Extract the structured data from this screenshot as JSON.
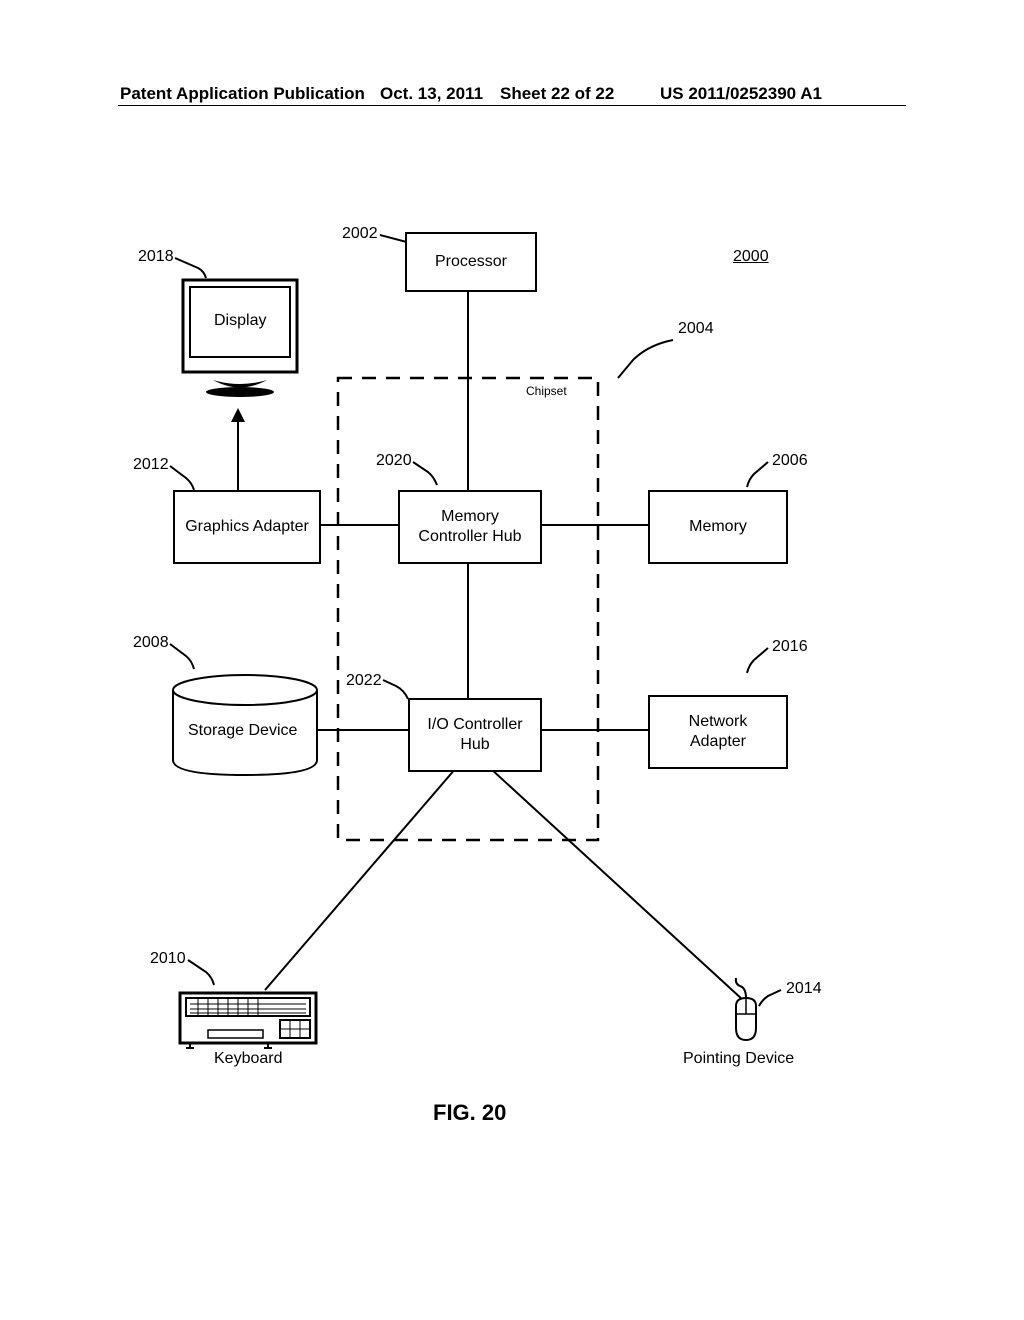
{
  "header": {
    "left": "Patent Application Publication",
    "date": "Oct. 13, 2011",
    "sheet": "Sheet 22 of 22",
    "right": "US 2011/0252390 A1"
  },
  "refs": {
    "r2000": "2000",
    "r2002": "2002",
    "r2004": "2004",
    "r2006": "2006",
    "r2008": "2008",
    "r2010": "2010",
    "r2012": "2012",
    "r2014": "2014",
    "r2016": "2016",
    "r2018": "2018",
    "r2020": "2020",
    "r2022": "2022"
  },
  "blocks": {
    "processor": "Processor",
    "chipset": "Chipset",
    "display": "Display",
    "graphics": "Graphics Adapter",
    "memctrl": "Memory\nController Hub",
    "memory": "Memory",
    "storage": "Storage Device",
    "ioctrl": "I/O Controller\nHub",
    "network": "Network\nAdapter",
    "keyboard": "Keyboard",
    "pointing": "Pointing Device"
  },
  "figure": "FIG. 20"
}
